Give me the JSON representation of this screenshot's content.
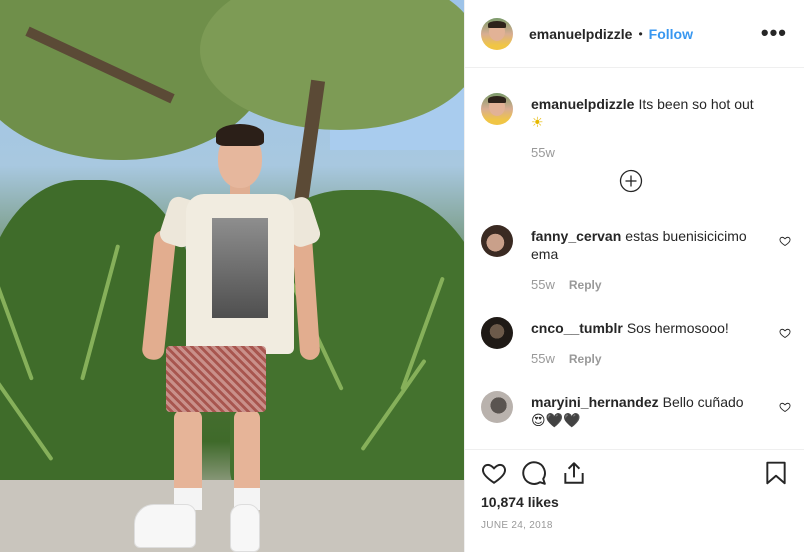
{
  "post": {
    "username": "emanuelpdizzle",
    "separator": "•",
    "follow_label": "Follow",
    "more_icon": "more-options-icon",
    "more_label": "•••"
  },
  "caption": {
    "username": "emanuelpdizzle",
    "text": "Its been so hot out",
    "emoji": "☀",
    "age": "55w"
  },
  "comments": [
    {
      "username": "fanny_cervan",
      "text": "estas buenisicicimo ema",
      "age": "55w",
      "reply_label": "Reply"
    },
    {
      "username": "cnco__tumblr",
      "text": "Sos hermosooo!",
      "age": "55w",
      "reply_label": "Reply"
    },
    {
      "username": "maryini_hernandez",
      "text": "Bello cuñado",
      "emoji": "😍🖤🖤"
    }
  ],
  "actions": {
    "likes": "10,874 likes",
    "date": "JUNE 24, 2018"
  },
  "colors": {
    "accent": "#3897f0",
    "text": "#262626",
    "muted": "#999999",
    "border": "#efefef"
  }
}
